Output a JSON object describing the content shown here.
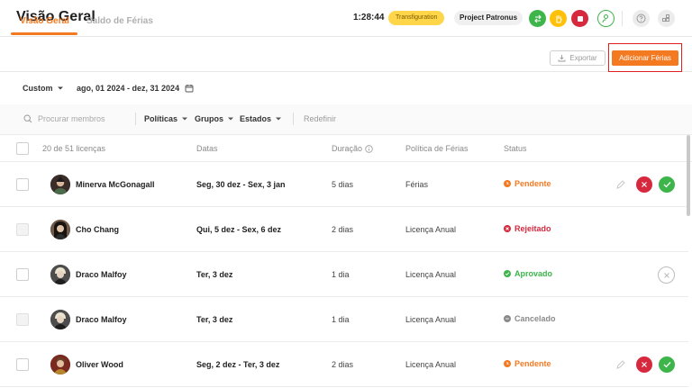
{
  "header": {
    "title": "Visão Geral",
    "timer": "1:28:44",
    "project_tag": "Transfiguration",
    "project_name": "Project Patronus",
    "colors": {
      "green": "#3db54a",
      "orange": "#ffc107",
      "red": "#d6293e",
      "accent": "#f47a22"
    }
  },
  "tabs": [
    {
      "label": "Visão Geral",
      "active": true
    },
    {
      "label": "Saldo de Férias",
      "active": false
    }
  ],
  "actions": {
    "export_label": "Exportar",
    "add_label": "Adicionar Férias"
  },
  "filters": {
    "period": "Custom",
    "date_range": "ago, 01 2024 - dez, 31 2024",
    "search_placeholder": "Procurar membros",
    "policies": "Políticas",
    "groups": "Grupos",
    "states": "Estados",
    "reset": "Redefinir"
  },
  "table": {
    "columns": {
      "count": "20 de 51 licenças",
      "dates": "Datas",
      "duration": "Duração",
      "policy": "Política de Férias",
      "status": "Status"
    },
    "rows": [
      {
        "name": "Minerva McGonagall",
        "dates": "Seg, 30 dez - Sex, 3 jan",
        "duration": "5 dias",
        "policy": "Férias",
        "status": "Pendente",
        "status_color": "#f47a22",
        "actions": "pending"
      },
      {
        "name": "Cho Chang",
        "dates": "Qui, 5 dez - Sex, 6 dez",
        "duration": "2 dias",
        "policy": "Licença Anual",
        "status": "Rejeitado",
        "status_color": "#d6293e",
        "actions": "none"
      },
      {
        "name": "Draco Malfoy",
        "dates": "Ter, 3 dez",
        "duration": "1 dia",
        "policy": "Licença Anual",
        "status": "Aprovado",
        "status_color": "#3db54a",
        "actions": "cancel"
      },
      {
        "name": "Draco Malfoy",
        "dates": "Ter, 3 dez",
        "duration": "1 dia",
        "policy": "Licença Anual",
        "status": "Cancelado",
        "status_color": "#8a8a8a",
        "actions": "none"
      },
      {
        "name": "Oliver Wood",
        "dates": "Seg, 2 dez - Ter, 3 dez",
        "duration": "2 dias",
        "policy": "Licença Anual",
        "status": "Pendente",
        "status_color": "#f47a22",
        "actions": "pending"
      }
    ]
  }
}
